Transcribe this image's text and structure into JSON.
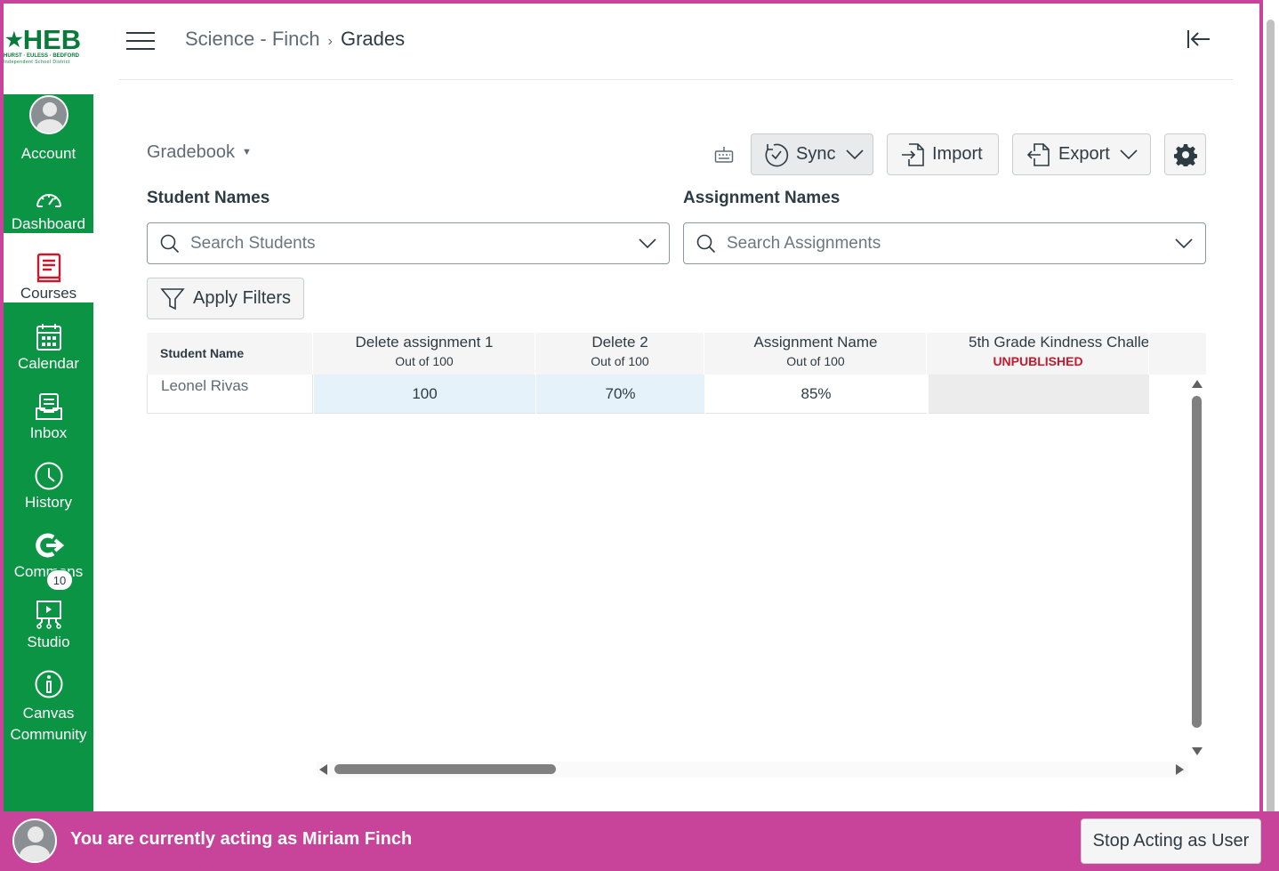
{
  "logo": {
    "text": "HEB",
    "sub": "HURST · EULESS · BEDFORD",
    "sub2": "Independent School District"
  },
  "global_nav": {
    "items": [
      {
        "label": "Account",
        "icon": "avatar-icon"
      },
      {
        "label": "Dashboard",
        "icon": "dashboard-icon"
      },
      {
        "label": "Courses",
        "icon": "courses-icon"
      },
      {
        "label": "Calendar",
        "icon": "calendar-icon"
      },
      {
        "label": "Inbox",
        "icon": "inbox-icon"
      },
      {
        "label": "History",
        "icon": "history-icon"
      },
      {
        "label": "Commons",
        "icon": "commons-icon"
      },
      {
        "label": "Studio",
        "icon": "studio-icon"
      },
      {
        "label": "Canvas Community",
        "icon": "community-icon",
        "badge": "10"
      }
    ],
    "active": "Courses"
  },
  "header": {
    "breadcrumb": [
      "Science - Finch",
      "Grades"
    ],
    "separator": "›"
  },
  "toolbar": {
    "gradebook_menu": "Gradebook",
    "sync_label": "Sync",
    "import_label": "Import",
    "export_label": "Export"
  },
  "filters": {
    "student_label": "Student Names",
    "student_placeholder": "Search Students",
    "assignment_label": "Assignment Names",
    "assignment_placeholder": "Search Assignments",
    "apply_label": "Apply Filters"
  },
  "grid": {
    "name_header": "Student Name",
    "columns": [
      {
        "title": "Delete assignment 1",
        "sub": "Out of 100"
      },
      {
        "title": "Delete 2",
        "sub": "Out of 100"
      },
      {
        "title": "Assignment Name",
        "sub": "Out of 100"
      },
      {
        "title": "5th Grade Kindness Challe",
        "status": "UNPUBLISHED"
      }
    ],
    "rows": [
      {
        "student": "Leonel Rivas",
        "grades": [
          "100",
          "70%",
          "85%",
          ""
        ]
      }
    ]
  },
  "masquerade": {
    "message": "You are currently acting as Miriam Finch",
    "stop_label": "Stop Acting as User"
  },
  "colors": {
    "nav_green": "#0b9444",
    "mask_pink": "#c8449b",
    "unpublished_red": "#c7182c"
  }
}
